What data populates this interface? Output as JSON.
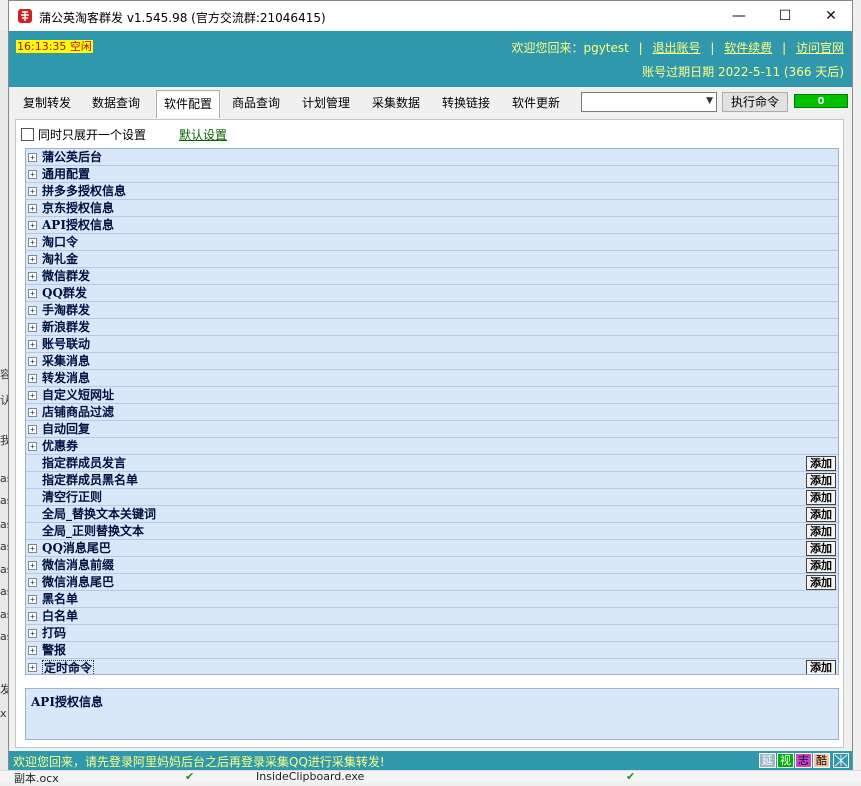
{
  "window": {
    "title": "蒲公英淘客群发 v1.545.98  (官方交流群:21046415)",
    "minimize": "—",
    "maximize": "☐",
    "close": "✕"
  },
  "header": {
    "clock": "16:13:35 空闲",
    "welcome_prefix": "欢迎您回来：pgytest",
    "links": [
      "退出账号",
      "软件续费",
      "访问官网"
    ],
    "separator": "|",
    "expire": "账号过期日期 2022-5-11 (366 天后)"
  },
  "tabs": {
    "items": [
      "复制转发",
      "数据查询",
      "软件配置",
      "商品查询",
      "计划管理",
      "采集数据",
      "转换链接",
      "软件更新"
    ],
    "active": "软件配置",
    "combo_value": "",
    "exec_label": "执行命令",
    "counter": "0"
  },
  "options": {
    "expand_one_label": "同时只展开一个设置",
    "default_link": "默认设置"
  },
  "tree": {
    "items": [
      {
        "label": "蒲公英后台",
        "expand": true,
        "add": false
      },
      {
        "label": "通用配置",
        "expand": true,
        "add": false
      },
      {
        "label": "拼多多授权信息",
        "expand": true,
        "add": false
      },
      {
        "label": "京东授权信息",
        "expand": true,
        "add": false
      },
      {
        "label": "API授权信息",
        "expand": true,
        "add": false
      },
      {
        "label": "淘口令",
        "expand": true,
        "add": false
      },
      {
        "label": "淘礼金",
        "expand": true,
        "add": false
      },
      {
        "label": "微信群发",
        "expand": true,
        "add": false
      },
      {
        "label": "QQ群发",
        "expand": true,
        "add": false
      },
      {
        "label": "手淘群发",
        "expand": true,
        "add": false
      },
      {
        "label": "新浪群发",
        "expand": true,
        "add": false
      },
      {
        "label": "账号联动",
        "expand": true,
        "add": false
      },
      {
        "label": "采集消息",
        "expand": true,
        "add": false
      },
      {
        "label": "转发消息",
        "expand": true,
        "add": false
      },
      {
        "label": "自定义短网址",
        "expand": true,
        "add": false
      },
      {
        "label": "店铺商品过滤",
        "expand": true,
        "add": false
      },
      {
        "label": "自动回复",
        "expand": true,
        "add": false
      },
      {
        "label": "优惠券",
        "expand": true,
        "add": false
      },
      {
        "label": "指定群成员发言",
        "expand": false,
        "add": true
      },
      {
        "label": "指定群成员黑名单",
        "expand": false,
        "add": true
      },
      {
        "label": "清空行正则",
        "expand": false,
        "add": true
      },
      {
        "label": "全局_替换文本关键词",
        "expand": false,
        "add": true
      },
      {
        "label": "全局_正则替换文本",
        "expand": false,
        "add": true
      },
      {
        "label": "QQ消息尾巴",
        "expand": true,
        "add": true
      },
      {
        "label": "微信消息前缀",
        "expand": true,
        "add": true
      },
      {
        "label": "微信消息尾巴",
        "expand": true,
        "add": true
      },
      {
        "label": "黑名单",
        "expand": true,
        "add": false
      },
      {
        "label": "白名单",
        "expand": true,
        "add": false
      },
      {
        "label": "打码",
        "expand": true,
        "add": false
      },
      {
        "label": "警报",
        "expand": true,
        "add": false
      },
      {
        "label": "定时命令",
        "expand": true,
        "add": true,
        "focused": true
      }
    ],
    "add_label": "添加",
    "expand_glyph": "+"
  },
  "description": {
    "title": "API授权信息"
  },
  "status": {
    "text": "欢迎您回来，请先登录阿里妈妈后台之后再登录采集QQ进行采集转发!",
    "badges": [
      {
        "label": "延",
        "bg": "#9fb8c8",
        "fg": "#ffffff"
      },
      {
        "label": "视",
        "bg": "#00b000",
        "fg": "#ffffff"
      },
      {
        "label": "志",
        "bg": "#d040d0",
        "fg": "#000000"
      },
      {
        "label": "酷",
        "bg": "#f7c7a0",
        "fg": "#000000"
      }
    ]
  },
  "background_window": {
    "left_chars": [
      "容",
      "认",
      "我",
      "as",
      "as",
      "as",
      "as",
      "as",
      "as",
      "as",
      "as",
      "发",
      "x"
    ],
    "bottom_items": [
      "副本.ocx",
      "InsideClipboard.exe"
    ]
  },
  "colors": {
    "header_bg": "#2f98ad",
    "header_text": "#ffff80",
    "tree_bg": "#d9e8f9",
    "counter_bg": "#00c000"
  }
}
